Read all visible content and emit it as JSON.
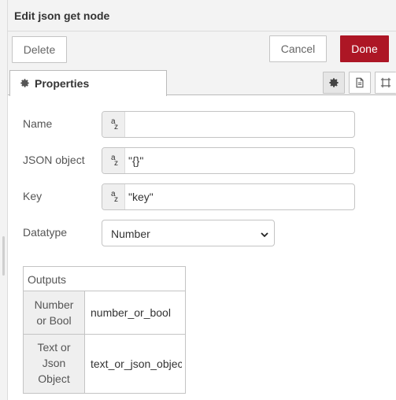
{
  "tray": {
    "title": "Edit json get node"
  },
  "toolbar": {
    "delete_label": "Delete",
    "cancel_label": "Cancel",
    "done_label": "Done",
    "done_color": "#ad1625"
  },
  "tabs": {
    "properties_label": "Properties"
  },
  "form": {
    "name": {
      "label": "Name",
      "type_letter_top": "a",
      "type_letter_bottom": "z",
      "value": ""
    },
    "json_object": {
      "label": "JSON object",
      "type_letter_top": "a",
      "type_letter_bottom": "z",
      "value": "\"{}\""
    },
    "key": {
      "label": "Key",
      "type_letter_top": "a",
      "type_letter_bottom": "z",
      "value": "\"key\""
    },
    "datatype": {
      "label": "Datatype",
      "selected": "Number"
    }
  },
  "outputs": {
    "title": "Outputs",
    "rows": [
      {
        "label_line1": "Number",
        "label_line2": "or Bool",
        "label_line3": "",
        "value": "number_or_bool"
      },
      {
        "label_line1": "Text or",
        "label_line2": "Json",
        "label_line3": "Object",
        "value": "text_or_json_object"
      }
    ]
  },
  "icons": {
    "tab_gear": "gear-icon",
    "tab_buttons": [
      "gear-icon",
      "document-icon",
      "frame-icon"
    ],
    "select_chevron": "chevron-down-icon"
  }
}
